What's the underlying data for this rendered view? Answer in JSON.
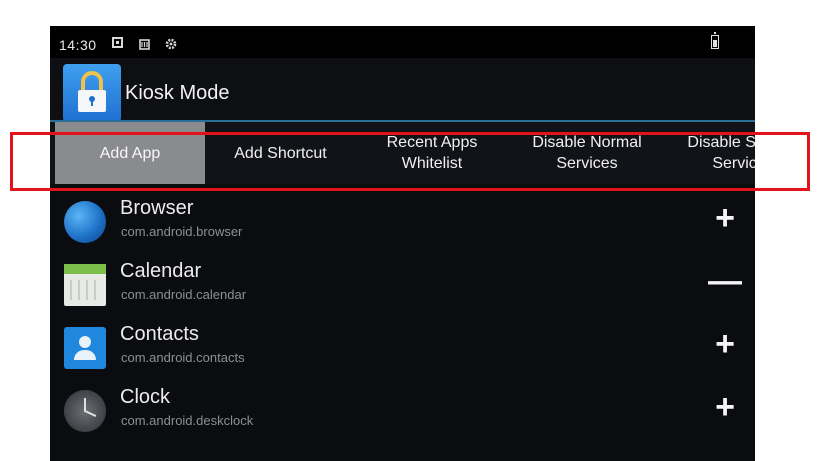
{
  "status_bar": {
    "time": "14:30",
    "icons": [
      "notification-icon",
      "sim-icon",
      "settings-icon",
      "battery-icon"
    ]
  },
  "action_bar": {
    "title": "Kiosk Mode",
    "icon": "lock-icon",
    "accent_color": "#2a6f9a"
  },
  "tabs": [
    {
      "label": "Add App",
      "selected": true
    },
    {
      "label": "Add Shortcut",
      "selected": false
    },
    {
      "label": "Recent Apps\nWhitelist",
      "selected": false
    },
    {
      "label": "Disable Normal\nServices",
      "selected": false
    },
    {
      "label": "Disable System\nServices",
      "selected": false
    }
  ],
  "apps": [
    {
      "name": "Browser",
      "package": "com.android.browser",
      "icon": "browser-globe-icon",
      "action": "+"
    },
    {
      "name": "Calendar",
      "package": "com.android.calendar",
      "icon": "calendar-icon",
      "action": "—"
    },
    {
      "name": "Contacts",
      "package": "com.android.contacts",
      "icon": "contacts-icon",
      "action": "+"
    },
    {
      "name": "Clock",
      "package": "com.android.deskclock",
      "icon": "clock-icon",
      "action": "+"
    }
  ],
  "highlight_color": "#e3131a"
}
